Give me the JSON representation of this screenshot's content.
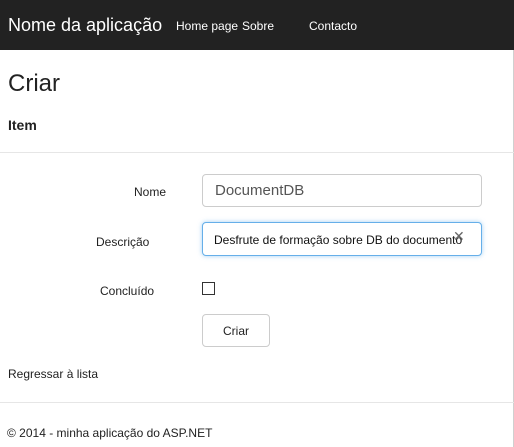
{
  "navbar": {
    "brand": "Nome da aplicação",
    "links": [
      "Home page",
      "Sobre",
      "Contacto"
    ]
  },
  "page": {
    "title": "Criar",
    "section": "Item"
  },
  "form": {
    "nome_label": "Nome",
    "nome_value": "DocumentDB",
    "descricao_label": "Descrição",
    "descricao_value": "Desfrute de formação sobre DB do documento",
    "concluido_label": "Concluído",
    "concluido_checked": false,
    "submit_label": "Criar"
  },
  "back_link": "Regressar à lista",
  "footer": "© 2014 - minha aplicação do ASP.NET",
  "colors": {
    "navbar_bg": "#222222",
    "focus_border": "#66afe9"
  },
  "icons": {
    "clear": "clear-icon"
  }
}
